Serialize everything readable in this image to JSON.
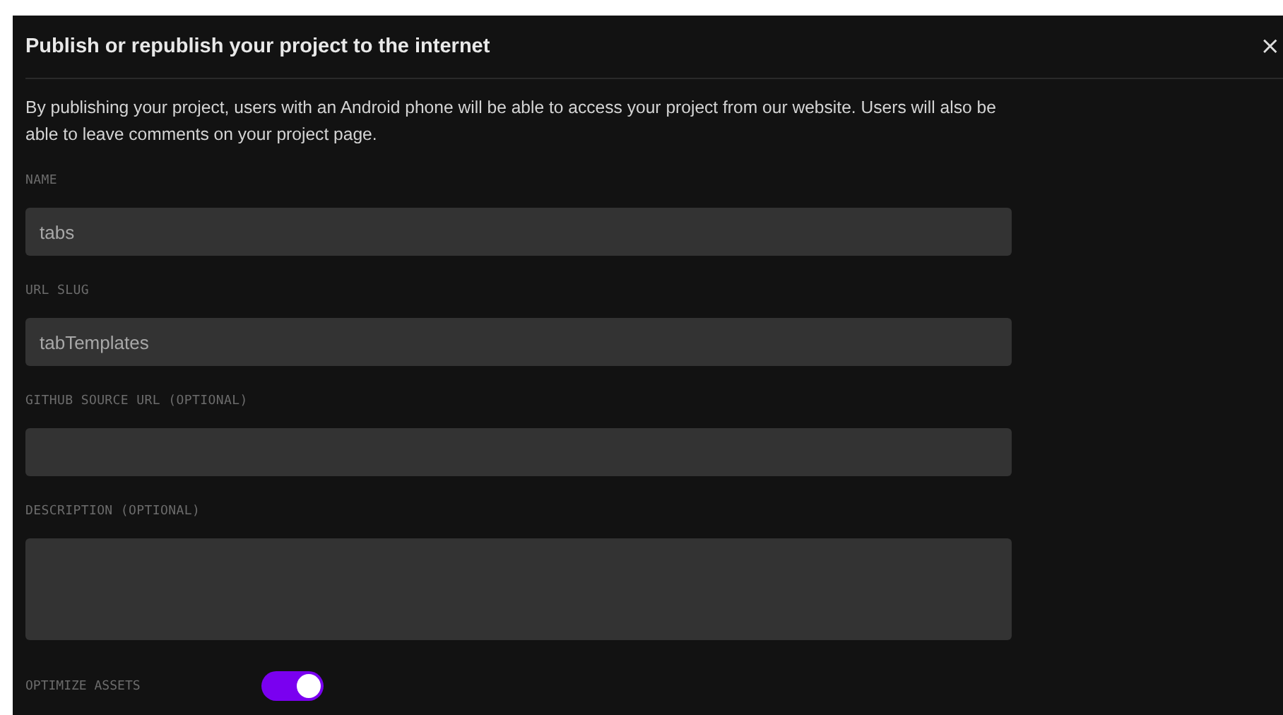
{
  "dialog": {
    "title": "Publish or republish your project to the internet",
    "close": "×"
  },
  "intro": "By publishing your project, users with an Android phone will be able to access your project from our website. Users will also be able to leave comments on your project page.",
  "fields": [
    {
      "label": "NAME",
      "value": "tabs",
      "kind": "input"
    },
    {
      "label": "URL SLUG",
      "value": "tabTemplates",
      "kind": "input"
    },
    {
      "label": "GITHUB SOURCE URL (OPTIONAL)",
      "kind": "input"
    },
    {
      "label": "DESCRIPTION (OPTIONAL)",
      "kind": "textarea"
    }
  ],
  "optimize": {
    "label": "OPTIMIZE ASSETS",
    "on": true
  }
}
